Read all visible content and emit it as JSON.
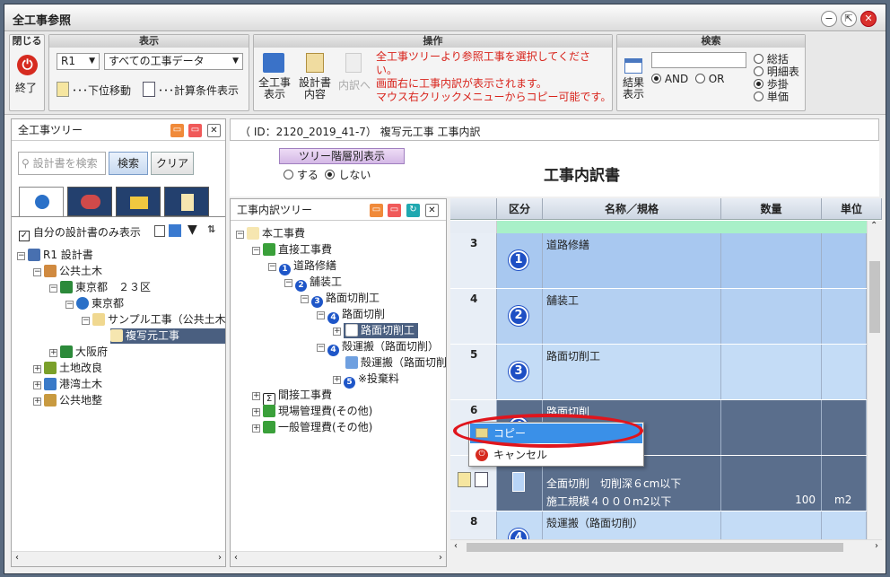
{
  "window": {
    "title": "全工事参照"
  },
  "toolbar": {
    "close_group": {
      "title": "閉じる",
      "exit_label": "終了"
    },
    "display_group": {
      "title": "表示",
      "year_select": "R1",
      "data_select": "すべての工事データ",
      "move_down_label": "･･･下位移動",
      "calc_condition_label": "･･･計算条件表示"
    },
    "operation_group": {
      "title": "操作",
      "btn_all_works": [
        "全工事",
        "表示"
      ],
      "btn_design_doc": [
        "設計書",
        "内容"
      ],
      "btn_detail": "内訳へ",
      "message_lines": [
        "全工事ツリーより参照工事を選択してください。",
        "画面右に工事内訳が表示されます。",
        "マウス右クリックメニューからコピー可能です。"
      ]
    },
    "search_group": {
      "title": "検索",
      "search_value": "",
      "result_label": [
        "結果",
        "表示"
      ],
      "and_label": "AND",
      "or_label": "OR",
      "options": [
        "総括",
        "明細表",
        "歩掛",
        "単価"
      ],
      "selected_option": "歩掛"
    }
  },
  "left_panel": {
    "title": "全工事ツリー",
    "search_placeholder": "設計書を検索",
    "search_button": "検索",
    "clear_button": "クリア",
    "own_only_label": "自分の設計書のみ表示",
    "tree": [
      {
        "label": "R1 設計書"
      },
      {
        "label": "公共土木"
      },
      {
        "label": "東京都　２３区"
      },
      {
        "label": "東京都"
      },
      {
        "label": "サンプル工事（公共土木"
      },
      {
        "label": "複写元工事"
      },
      {
        "label": "大阪府"
      },
      {
        "label": "土地改良"
      },
      {
        "label": "港湾土木"
      },
      {
        "label": "公共地整"
      }
    ]
  },
  "right_header": {
    "id_line": "（ ID：2120_2019_41-7）  複写元工事  工事内訳",
    "tree_toggle_button": "ツリー階層別表示",
    "radio_yes": "する",
    "radio_no": "しない",
    "doc_title": "工事内訳書"
  },
  "mid_panel": {
    "title": "工事内訳ツリー",
    "tree": [
      {
        "label": "本工事費"
      },
      {
        "label": "直接工事費"
      },
      {
        "num": "1",
        "label": "道路修繕"
      },
      {
        "num": "2",
        "label": "舗装工"
      },
      {
        "num": "3",
        "label": "路面切削工"
      },
      {
        "num": "4",
        "label": "路面切削"
      },
      {
        "label": "路面切削工"
      },
      {
        "num": "4",
        "label": "殻運搬（路面切削）"
      },
      {
        "label": "殻運搬（路面切削"
      },
      {
        "num": "5",
        "label": "※投棄料"
      },
      {
        "label": "間接工事費"
      },
      {
        "label": "現場管理費(その他)"
      },
      {
        "label": "一般管理費(その他)"
      }
    ]
  },
  "grid": {
    "headers": [
      "区分",
      "名称／規格",
      "数量",
      "単位"
    ],
    "rows": [
      {
        "no": "3",
        "badge": "1",
        "name": "道路修繕"
      },
      {
        "no": "4",
        "badge": "2",
        "name": "舗装工"
      },
      {
        "no": "5",
        "badge": "3",
        "name": "路面切削工"
      },
      {
        "no": "6",
        "badge": "4",
        "name": "路面切削"
      },
      {
        "no": "",
        "badge": "",
        "name": "全面切削　切削深６cm以下",
        "name2": "施工規模４０００m2以下",
        "qty": "100",
        "unit": "m2"
      },
      {
        "no": "8",
        "badge": "4",
        "name": "殻運搬（路面切削）"
      }
    ]
  },
  "context_menu": {
    "copy": "コピー",
    "cancel": "キャンセル"
  },
  "colors": {
    "highlight_annotation": "#e0151d",
    "selected_row": "#5a6e8c",
    "light_row": "#a8c8f0"
  }
}
